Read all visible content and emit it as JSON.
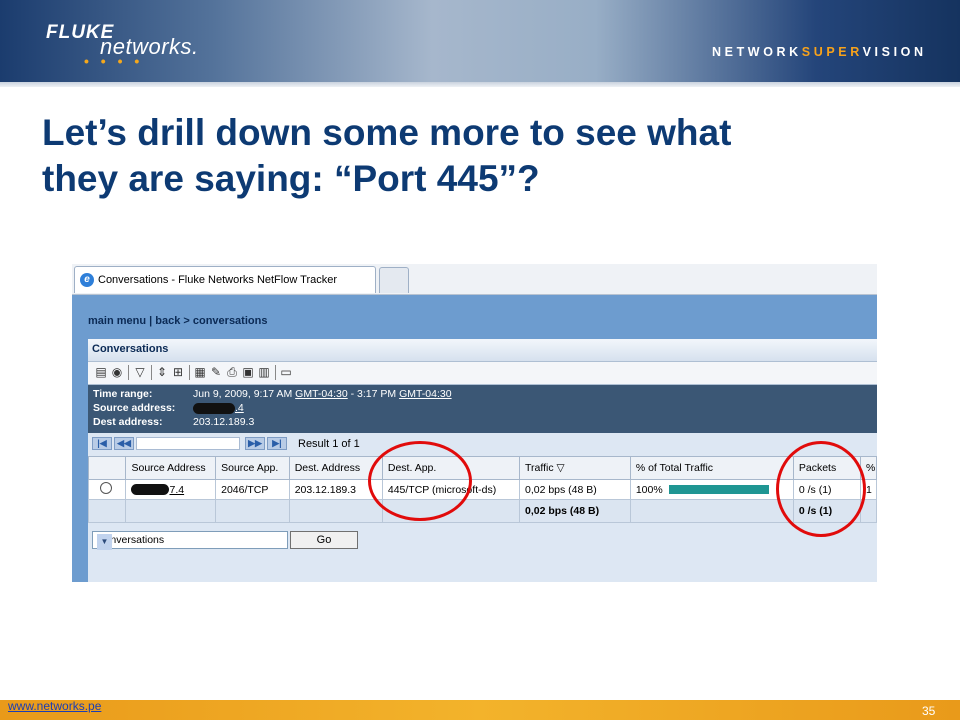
{
  "header": {
    "brand_primary": "FLUKE",
    "brand_secondary": "networks.",
    "tagline_a": "NETWORK",
    "tagline_b": "SUPER",
    "tagline_c": "VISION"
  },
  "slide": {
    "title_line1": "Let’s drill down some more to see what",
    "title_line2": "they are saying: “Port 445”?",
    "footer_link": "www.networks.pe",
    "page_number": "35"
  },
  "browser": {
    "tab_title": "Conversations - Fluke Networks NetFlow Tracker",
    "tab_icon": "ie-icon"
  },
  "app": {
    "nav": "main menu | back > conversations",
    "panel_title": "Conversations",
    "info": {
      "time_label": "Time range:",
      "time_value": "Jun 9, 2009, 9:17 AM",
      "tz1": "GMT-04:30",
      "time_mid": " - 3:17 PM ",
      "tz2": "GMT-04:30",
      "source_label": "Source address:",
      "source_visible": ".4",
      "dest_label": "Dest address:",
      "dest_value": "203.12.189.3"
    },
    "pager": {
      "first": "|◀",
      "prev": "◀◀",
      "next": "▶▶",
      "last": "▶|",
      "result": "Result 1 of 1"
    },
    "table": {
      "columns": [
        "",
        "Source Address",
        "Source App.",
        "Dest. Address",
        "Dest. App.",
        "Traffic ▽",
        "% of Total Traffic",
        "Packets",
        "%"
      ],
      "row": {
        "source_address_visible": "7.4",
        "source_app": "2046/TCP",
        "dest_address": "203.12.189.3",
        "dest_app": "445/TCP (microsoft-ds)",
        "traffic": "0,02 bps (48 B)",
        "pct_total": "100%",
        "pct_fraction": 1.0,
        "packets": "0 /s (1)",
        "pct_packets": "1"
      },
      "totals": {
        "traffic": "0,02 bps (48 B)",
        "packets": "0 /s (1)"
      }
    },
    "view_select": "Conversations",
    "go_button": "Go"
  },
  "colors": {
    "title": "#0d3a73",
    "annotation": "#e10b0b",
    "bar": "#1f9693",
    "footer": "#f3b32b"
  }
}
